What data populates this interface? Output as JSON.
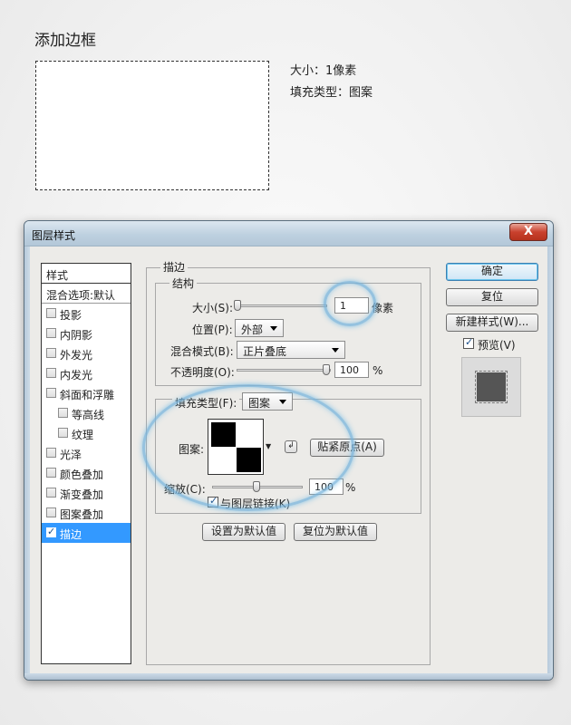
{
  "page": {
    "title": "添加边框",
    "size_text": "大小：1像素",
    "fill_text": "填充类型：图案"
  },
  "dialog": {
    "title": "图层样式",
    "close_label": "X",
    "left": {
      "header": "样式",
      "blend": "混合选项:默认",
      "items": [
        {
          "label": "投影",
          "indent": false,
          "checked": false
        },
        {
          "label": "内阴影",
          "indent": false,
          "checked": false
        },
        {
          "label": "外发光",
          "indent": false,
          "checked": false
        },
        {
          "label": "内发光",
          "indent": false,
          "checked": false
        },
        {
          "label": "斜面和浮雕",
          "indent": false,
          "checked": false
        },
        {
          "label": "等高线",
          "indent": true,
          "checked": false
        },
        {
          "label": "纹理",
          "indent": true,
          "checked": false
        },
        {
          "label": "光泽",
          "indent": false,
          "checked": false
        },
        {
          "label": "颜色叠加",
          "indent": false,
          "checked": false
        },
        {
          "label": "渐变叠加",
          "indent": false,
          "checked": false
        },
        {
          "label": "图案叠加",
          "indent": false,
          "checked": false
        },
        {
          "label": "描边",
          "indent": false,
          "checked": true
        }
      ]
    },
    "stroke": {
      "legend": "描边",
      "structure_legend": "结构",
      "size_label": "大小(S):",
      "size_value": "1",
      "size_unit": "像素",
      "position_label": "位置(P):",
      "position_value": "外部",
      "blend_label": "混合模式(B):",
      "blend_value": "正片叠底",
      "opacity_label": "不透明度(O):",
      "opacity_value": "100",
      "opacity_unit": "%",
      "fill_type_label": "填充类型(F):",
      "fill_type_value": "图案",
      "pattern_label": "图案:",
      "snap_origin": "贴紧原点(A)",
      "scale_label": "缩放(C):",
      "scale_value": "100",
      "scale_unit": "%",
      "link_label": "与图层链接(K)",
      "link_checked": true,
      "set_default": "设置为默认值",
      "reset_default": "复位为默认值"
    },
    "buttons": {
      "ok": "确定",
      "reset": "复位",
      "new_style": "新建样式(W)...",
      "preview_label": "预览(V)",
      "preview_checked": true
    }
  }
}
